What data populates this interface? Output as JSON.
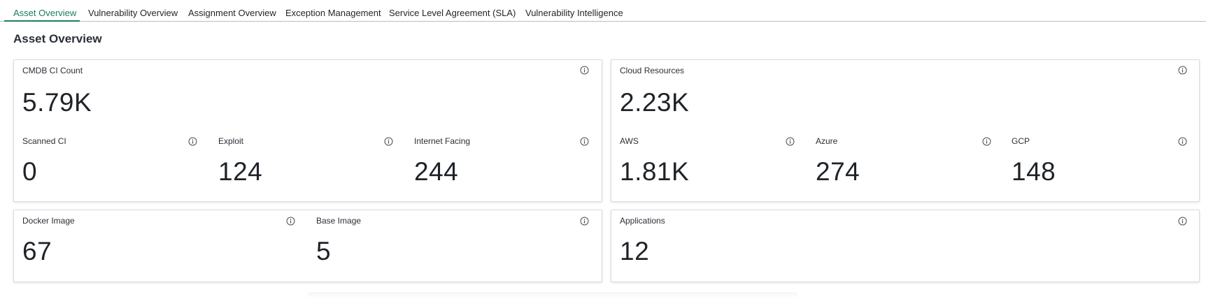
{
  "tabs": [
    {
      "label": "Asset Overview",
      "active": true
    },
    {
      "label": "Vulnerability Overview"
    },
    {
      "label": "Assignment Overview"
    },
    {
      "label": "Exception Management"
    },
    {
      "label": "Service Level Agreement (SLA)"
    },
    {
      "label": "Vulnerability Intelligence"
    }
  ],
  "page": {
    "title": "Asset Overview"
  },
  "cmdb": {
    "main": {
      "label": "CMDB CI Count",
      "value": "5.79K"
    },
    "scanned": {
      "label": "Scanned CI",
      "value": "0"
    },
    "exploit": {
      "label": "Exploit",
      "value": "124"
    },
    "internet": {
      "label": "Internet Facing",
      "value": "244"
    }
  },
  "cloud": {
    "main": {
      "label": "Cloud Resources",
      "value": "2.23K"
    },
    "aws": {
      "label": "AWS",
      "value": "1.81K"
    },
    "azure": {
      "label": "Azure",
      "value": "274"
    },
    "gcp": {
      "label": "GCP",
      "value": "148"
    }
  },
  "docker": {
    "docker_image": {
      "label": "Docker Image",
      "value": "67"
    },
    "base_image": {
      "label": "Base Image",
      "value": "5"
    }
  },
  "applications": {
    "label": "Applications",
    "value": "12"
  },
  "colors": {
    "accent": "#1a7f5a",
    "border": "#d9dce0"
  }
}
